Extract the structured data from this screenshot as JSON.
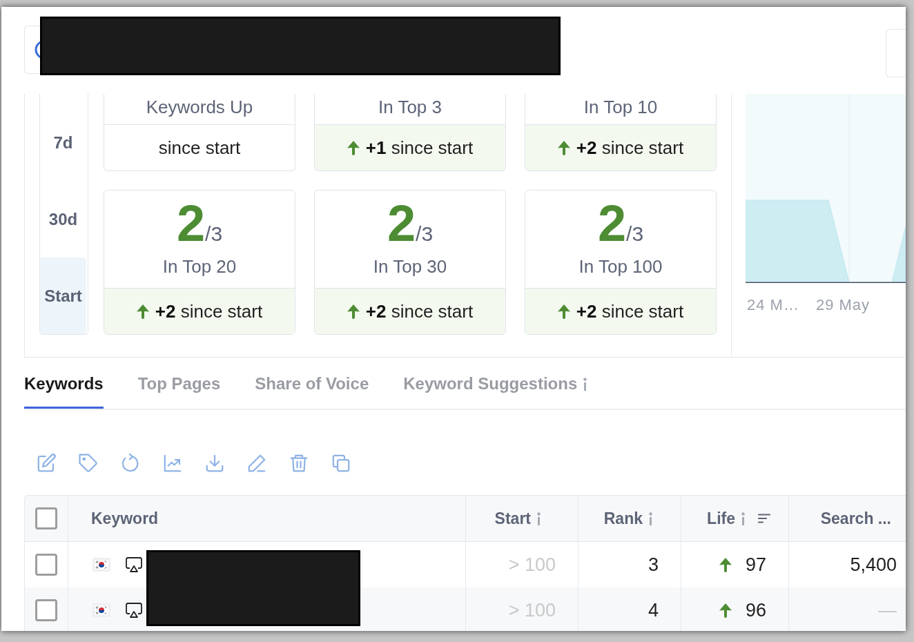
{
  "search_field": {
    "redacted": true
  },
  "periods": [
    {
      "label": "7d",
      "selected": false
    },
    {
      "label": "30d",
      "selected": false
    },
    {
      "label": "Start",
      "selected": true
    }
  ],
  "stat_cards": [
    {
      "label": "Keywords Up",
      "change": "since start",
      "up": false
    },
    {
      "label": "In Top 3",
      "change": "**+1** since start",
      "up": true
    },
    {
      "label": "In Top 10",
      "change": "**+2** since start",
      "up": true
    },
    {
      "value": "2",
      "total": "/3",
      "label": "In Top 20",
      "change": "**+2** since start",
      "up": true
    },
    {
      "value": "2",
      "total": "/3",
      "label": "In Top 30",
      "change": "**+2** since start",
      "up": true
    },
    {
      "value": "2",
      "total": "/3",
      "label": "In Top 100",
      "change": "**+2** since start",
      "up": true
    }
  ],
  "chart": {
    "x_labels": [
      "24 M…",
      "29 May"
    ]
  },
  "tabs": [
    {
      "label": "Keywords",
      "selected": true,
      "info": false
    },
    {
      "label": "Top Pages",
      "selected": false,
      "info": false
    },
    {
      "label": "Share of Voice",
      "selected": false,
      "info": false
    },
    {
      "label": "Keyword Suggestions",
      "selected": false,
      "info": true
    }
  ],
  "table": {
    "select_all": {
      "checked": false
    },
    "columns": [
      {
        "label": "Keyword",
        "info": false,
        "sort": false
      },
      {
        "label": "Start",
        "info": true,
        "sort": false
      },
      {
        "label": "Rank",
        "info": true,
        "sort": false
      },
      {
        "label": "Life",
        "info": true,
        "sort": true
      },
      {
        "label": "Search ...",
        "info": false,
        "sort": false
      }
    ],
    "keyword_redacted": true,
    "rows": [
      {
        "checked": false,
        "start": "> 100",
        "rank": "3",
        "life_up": true,
        "life": "97",
        "search": "5,400",
        "search_muted": false
      },
      {
        "checked": false,
        "start": "> 100",
        "rank": "4",
        "life_up": true,
        "life": "96",
        "search": "—",
        "search_muted": true
      }
    ]
  }
}
